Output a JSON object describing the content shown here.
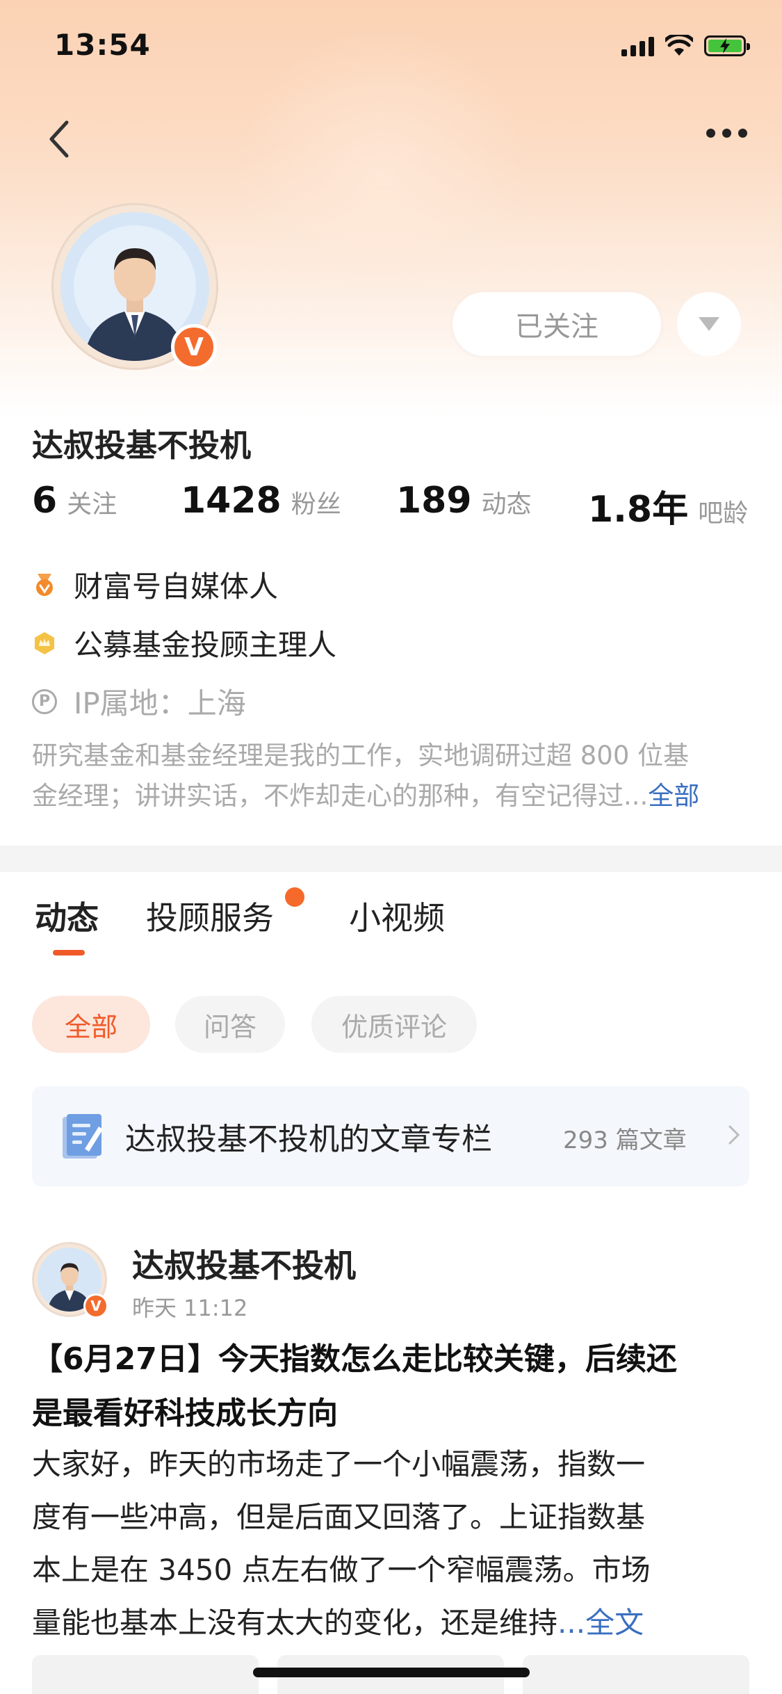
{
  "status_bar": {
    "time": "13:54",
    "icons": [
      "signal-icon",
      "wifi-icon",
      "battery-charging-icon"
    ]
  },
  "nav": {
    "back_icon": "chevron-left-icon",
    "more_icon": "more-dots-icon"
  },
  "profile": {
    "name": "达叔投基不投机",
    "verified_badge": "V",
    "follow_button": "已关注",
    "dropdown_icon": "triangle-down-icon",
    "stats": [
      {
        "value": "6",
        "label": "关注"
      },
      {
        "value": "1428",
        "label": "粉丝"
      },
      {
        "value": "189",
        "label": "动态"
      },
      {
        "value": "1.8年",
        "label": "吧龄"
      }
    ],
    "tags": [
      {
        "icon": "orange-medal-icon",
        "text": "财富号自媒体人"
      },
      {
        "icon": "gold-crown-badge-icon",
        "text": "公募基金投顾主理人"
      }
    ],
    "ip": {
      "icon": "p-circle-icon",
      "text": "IP属地：上海"
    },
    "bio_line1": "研究基金和基金经理是我的工作，实地调研过超 800 位基",
    "bio_line2": "金经理；讲讲实话，不炸却走心的那种，有空记得过...",
    "bio_more": "全部"
  },
  "tabs": [
    {
      "label": "动态",
      "active": true
    },
    {
      "label": "投顾服务",
      "active": false,
      "has_dot": true
    },
    {
      "label": "小视频",
      "active": false
    }
  ],
  "filters": [
    {
      "label": "全部",
      "active": true
    },
    {
      "label": "问答",
      "active": false
    },
    {
      "label": "优质评论",
      "active": false
    }
  ],
  "column_card": {
    "icon": "document-icon",
    "title": "达叔投基不投机的文章专栏",
    "count": "293 篇文章",
    "chevron": "chevron-right-icon"
  },
  "post": {
    "author": "达叔投基不投机",
    "verified_badge": "V",
    "time": "昨天 11:12",
    "title_line1": "【6月27日】今天指数怎么走比较关键，后续还",
    "title_line2": "是最看好科技成长方向",
    "body_line1": "大家好，昨天的市场走了一个小幅震荡，指数一",
    "body_line2": "度有一些冲高，但是后面又回落了。上证指数基",
    "body_line3": "本上是在 3450 点左右做了一个窄幅震荡。市场",
    "body_line4": "量能也基本上没有太大的变化，还是维持",
    "body_ellipsis": "...",
    "body_more": "全文"
  },
  "colors": {
    "accent": "#f05a28",
    "badge": "#f36c2d",
    "link": "#3a6fc0",
    "header_gradient_top": "#fbd2b4"
  }
}
